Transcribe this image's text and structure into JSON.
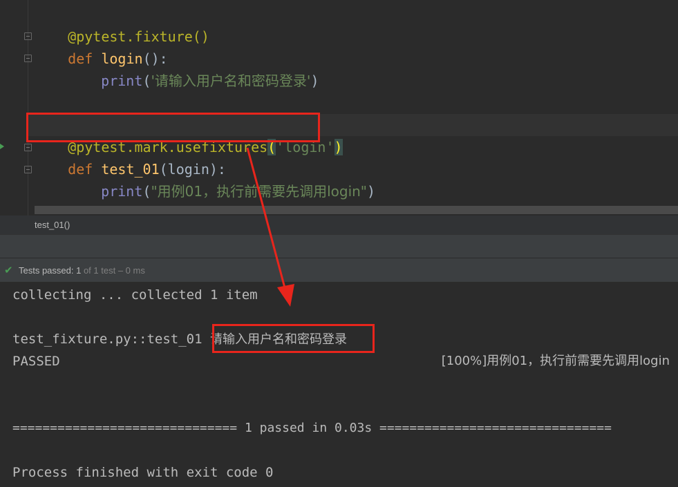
{
  "editor": {
    "lines": [
      {
        "decorator": "@pytest.fixture()"
      },
      {
        "kw": "def",
        "fn": "login",
        "rest": "():"
      },
      {
        "builtin": "print",
        "open": "(",
        "str": "'请输入用户名和密码登录'",
        "close": ")"
      },
      {
        "decorator": "@pytest.mark.usefixtures",
        "open": "(",
        "str": "'login'",
        "close": ")"
      },
      {
        "kw": "def",
        "fn": "test_01",
        "rest": "(login):"
      },
      {
        "builtin": "print",
        "open": "(",
        "str": "\"用例01，执行前需要先调用login\"",
        "close": ")"
      }
    ]
  },
  "breadcrumb": "test_01()",
  "status": {
    "label": "Tests passed: ",
    "passed": "1",
    "detail": " of 1 test – 0 ms"
  },
  "console": {
    "collecting": "collecting ... collected 1 item",
    "test_id": "test_fixture.py::test_01",
    "output1": "请输入用户名和密码登录",
    "passed": "PASSED",
    "output2": "[100%]用例01，执行前需要先调用login",
    "summary": "============================== 1 passed in 0.03s ===============================",
    "finished": "Process finished with exit code 0"
  },
  "colors": {
    "annotation": "#e8251c",
    "pass_green": "#499c54"
  }
}
